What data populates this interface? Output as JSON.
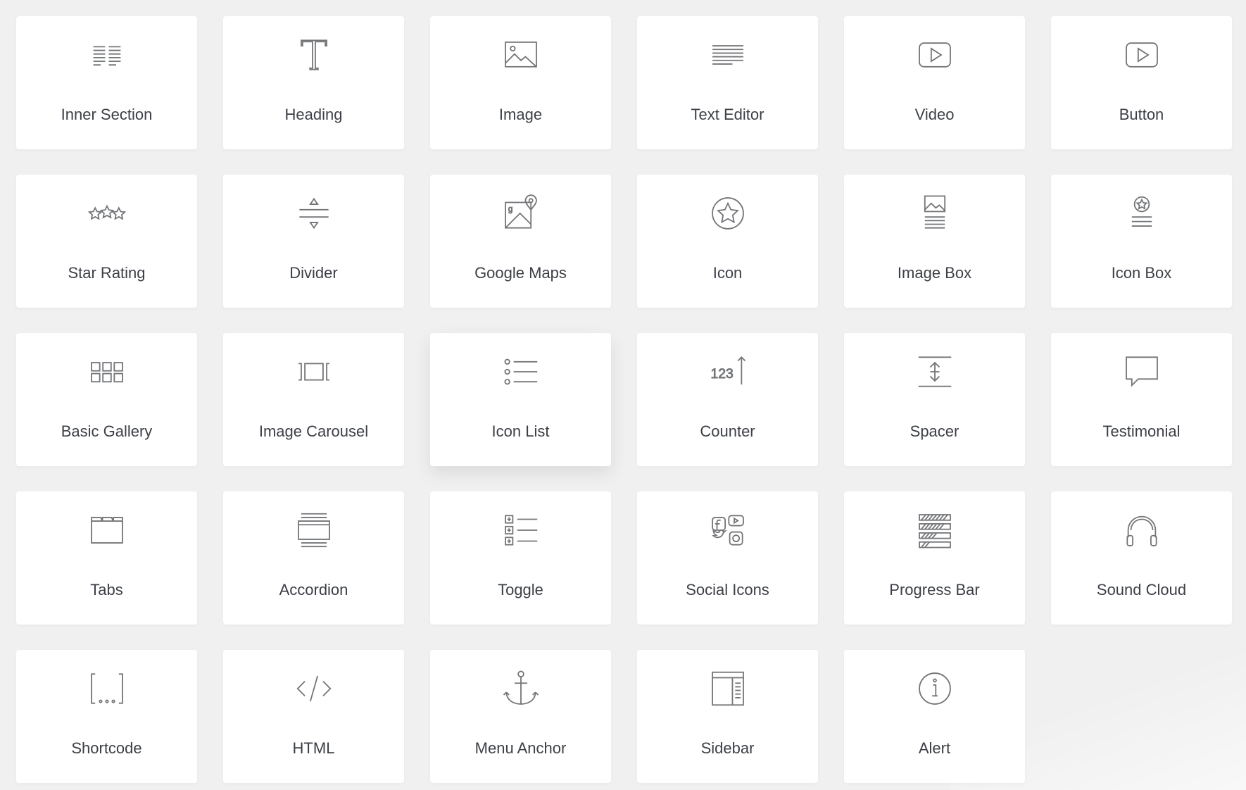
{
  "widgets": [
    {
      "label": "Inner Section",
      "icon": "columns-icon"
    },
    {
      "label": "Heading",
      "icon": "heading-t-icon"
    },
    {
      "label": "Image",
      "icon": "image-icon"
    },
    {
      "label": "Text Editor",
      "icon": "text-lines-icon"
    },
    {
      "label": "Video",
      "icon": "video-play-icon"
    },
    {
      "label": "Button",
      "icon": "button-play-icon"
    },
    {
      "label": "Star Rating",
      "icon": "stars-icon"
    },
    {
      "label": "Divider",
      "icon": "divider-icon"
    },
    {
      "label": "Google Maps",
      "icon": "map-pin-icon"
    },
    {
      "label": "Icon",
      "icon": "star-circle-icon"
    },
    {
      "label": "Image Box",
      "icon": "image-box-icon"
    },
    {
      "label": "Icon Box",
      "icon": "icon-box-icon"
    },
    {
      "label": "Basic Gallery",
      "icon": "gallery-grid-icon"
    },
    {
      "label": "Image Carousel",
      "icon": "carousel-icon"
    },
    {
      "label": "Icon List",
      "icon": "list-bullets-icon",
      "hovered": true
    },
    {
      "label": "Counter",
      "icon": "counter-icon"
    },
    {
      "label": "Spacer",
      "icon": "spacer-icon"
    },
    {
      "label": "Testimonial",
      "icon": "speech-bubble-icon"
    },
    {
      "label": "Tabs",
      "icon": "folder-tabs-icon"
    },
    {
      "label": "Accordion",
      "icon": "accordion-icon"
    },
    {
      "label": "Toggle",
      "icon": "toggle-list-icon"
    },
    {
      "label": "Social Icons",
      "icon": "social-icon"
    },
    {
      "label": "Progress Bar",
      "icon": "progress-bars-icon"
    },
    {
      "label": "Sound Cloud",
      "icon": "headphones-icon"
    },
    {
      "label": "Shortcode",
      "icon": "shortcode-icon"
    },
    {
      "label": "HTML",
      "icon": "code-icon"
    },
    {
      "label": "Menu Anchor",
      "icon": "anchor-icon"
    },
    {
      "label": "Sidebar",
      "icon": "sidebar-icon"
    },
    {
      "label": "Alert",
      "icon": "info-circle-icon"
    }
  ]
}
